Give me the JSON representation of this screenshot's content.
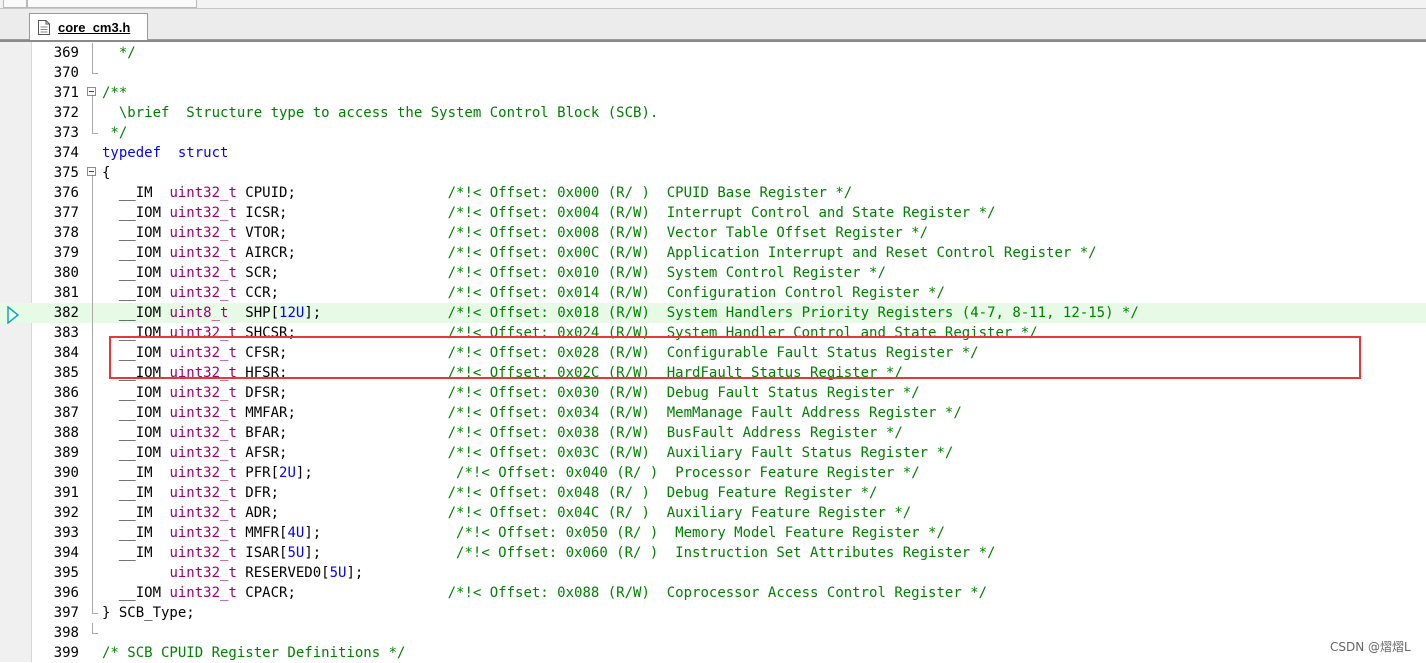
{
  "window": {
    "tab_label": "core_cm3.h",
    "watermark": "CSDN @熠熠L"
  },
  "colors": {
    "keyword": "#0000ff",
    "type": "#a0006a",
    "comment": "#008000",
    "number": "#0000ff",
    "highlight_bg": "#e6fae6",
    "annotation_box": "#e53935"
  },
  "editor": {
    "current_line": 382,
    "lines": [
      {
        "n": "369",
        "fold": "mid",
        "segs": [
          [
            "cm",
            "  */"
          ]
        ]
      },
      {
        "n": "370",
        "fold": "end",
        "segs": []
      },
      {
        "n": "371",
        "fold": "box",
        "segs": [
          [
            "cm",
            "/**"
          ]
        ]
      },
      {
        "n": "372",
        "fold": "mid",
        "segs": [
          [
            "cm",
            "  \\brief  Structure type to access the System Control Block (SCB)."
          ]
        ]
      },
      {
        "n": "373",
        "fold": "end",
        "segs": [
          [
            "cm",
            " */"
          ]
        ]
      },
      {
        "n": "374",
        "fold": "",
        "segs": [
          [
            "kw",
            "typedef"
          ],
          [
            "",
            "  "
          ],
          [
            "kw",
            "struct"
          ]
        ]
      },
      {
        "n": "375",
        "fold": "box",
        "segs": [
          [
            "",
            "{"
          ]
        ]
      },
      {
        "n": "376",
        "fold": "mid",
        "segs": [
          [
            "",
            "  __IM  "
          ],
          [
            "ty",
            "uint32_t"
          ],
          [
            "",
            " CPUID;                  "
          ],
          [
            "cm",
            "/*!< Offset: 0x000 (R/ )  CPUID Base Register */"
          ]
        ]
      },
      {
        "n": "377",
        "fold": "mid",
        "segs": [
          [
            "",
            "  __IOM "
          ],
          [
            "ty",
            "uint32_t"
          ],
          [
            "",
            " ICSR;                   "
          ],
          [
            "cm",
            "/*!< Offset: 0x004 (R/W)  Interrupt Control and State Register */"
          ]
        ]
      },
      {
        "n": "378",
        "fold": "mid",
        "segs": [
          [
            "",
            "  __IOM "
          ],
          [
            "ty",
            "uint32_t"
          ],
          [
            "",
            " VTOR;                   "
          ],
          [
            "cm",
            "/*!< Offset: 0x008 (R/W)  Vector Table Offset Register */"
          ]
        ]
      },
      {
        "n": "379",
        "fold": "mid",
        "segs": [
          [
            "",
            "  __IOM "
          ],
          [
            "ty",
            "uint32_t"
          ],
          [
            "",
            " AIRCR;                  "
          ],
          [
            "cm",
            "/*!< Offset: 0x00C (R/W)  Application Interrupt and Reset Control Register */"
          ]
        ]
      },
      {
        "n": "380",
        "fold": "mid",
        "segs": [
          [
            "",
            "  __IOM "
          ],
          [
            "ty",
            "uint32_t"
          ],
          [
            "",
            " SCR;                    "
          ],
          [
            "cm",
            "/*!< Offset: 0x010 (R/W)  System Control Register */"
          ]
        ]
      },
      {
        "n": "381",
        "fold": "mid",
        "segs": [
          [
            "",
            "  __IOM "
          ],
          [
            "ty",
            "uint32_t"
          ],
          [
            "",
            " CCR;                    "
          ],
          [
            "cm",
            "/*!< Offset: 0x014 (R/W)  Configuration Control Register */"
          ]
        ]
      },
      {
        "n": "382",
        "fold": "mid",
        "highlight": true,
        "segs": [
          [
            "",
            "  __IOM "
          ],
          [
            "ty",
            "uint8_t"
          ],
          [
            "",
            "  SHP["
          ],
          [
            "nm",
            "12U"
          ],
          [
            "",
            "];               "
          ],
          [
            "cm",
            "/*!< Offset: 0x018 (R/W)  System Handlers Priority Registers (4-7, 8-11, 12-15) */"
          ]
        ]
      },
      {
        "n": "383",
        "fold": "mid",
        "segs": [
          [
            "",
            "  __IOM "
          ],
          [
            "ty",
            "uint32_t"
          ],
          [
            "",
            " SHCSR;                  "
          ],
          [
            "cm",
            "/*!< Offset: 0x024 (R/W)  System Handler Control and State Register */"
          ]
        ]
      },
      {
        "n": "384",
        "fold": "mid",
        "segs": [
          [
            "",
            "  __IOM "
          ],
          [
            "ty",
            "uint32_t"
          ],
          [
            "",
            " CFSR;                   "
          ],
          [
            "cm",
            "/*!< Offset: 0x028 (R/W)  Configurable Fault Status Register */"
          ]
        ]
      },
      {
        "n": "385",
        "fold": "mid",
        "segs": [
          [
            "",
            "  __IOM "
          ],
          [
            "ty",
            "uint32_t"
          ],
          [
            "",
            " HFSR;                   "
          ],
          [
            "cm",
            "/*!< Offset: 0x02C (R/W)  HardFault Status Register */"
          ]
        ]
      },
      {
        "n": "386",
        "fold": "mid",
        "segs": [
          [
            "",
            "  __IOM "
          ],
          [
            "ty",
            "uint32_t"
          ],
          [
            "",
            " DFSR;                   "
          ],
          [
            "cm",
            "/*!< Offset: 0x030 (R/W)  Debug Fault Status Register */"
          ]
        ]
      },
      {
        "n": "387",
        "fold": "mid",
        "segs": [
          [
            "",
            "  __IOM "
          ],
          [
            "ty",
            "uint32_t"
          ],
          [
            "",
            " MMFAR;                  "
          ],
          [
            "cm",
            "/*!< Offset: 0x034 (R/W)  MemManage Fault Address Register */"
          ]
        ]
      },
      {
        "n": "388",
        "fold": "mid",
        "segs": [
          [
            "",
            "  __IOM "
          ],
          [
            "ty",
            "uint32_t"
          ],
          [
            "",
            " BFAR;                   "
          ],
          [
            "cm",
            "/*!< Offset: 0x038 (R/W)  BusFault Address Register */"
          ]
        ]
      },
      {
        "n": "389",
        "fold": "mid",
        "segs": [
          [
            "",
            "  __IOM "
          ],
          [
            "ty",
            "uint32_t"
          ],
          [
            "",
            " AFSR;                   "
          ],
          [
            "cm",
            "/*!< Offset: 0x03C (R/W)  Auxiliary Fault Status Register */"
          ]
        ]
      },
      {
        "n": "390",
        "fold": "mid",
        "segs": [
          [
            "",
            "  __IM  "
          ],
          [
            "ty",
            "uint32_t"
          ],
          [
            "",
            " PFR["
          ],
          [
            "nm",
            "2U"
          ],
          [
            "",
            "];                 "
          ],
          [
            "cm",
            "/*!< Offset: 0x040 (R/ )  Processor Feature Register */"
          ]
        ]
      },
      {
        "n": "391",
        "fold": "mid",
        "segs": [
          [
            "",
            "  __IM  "
          ],
          [
            "ty",
            "uint32_t"
          ],
          [
            "",
            " DFR;                    "
          ],
          [
            "cm",
            "/*!< Offset: 0x048 (R/ )  Debug Feature Register */"
          ]
        ]
      },
      {
        "n": "392",
        "fold": "mid",
        "segs": [
          [
            "",
            "  __IM  "
          ],
          [
            "ty",
            "uint32_t"
          ],
          [
            "",
            " ADR;                    "
          ],
          [
            "cm",
            "/*!< Offset: 0x04C (R/ )  Auxiliary Feature Register */"
          ]
        ]
      },
      {
        "n": "393",
        "fold": "mid",
        "segs": [
          [
            "",
            "  __IM  "
          ],
          [
            "ty",
            "uint32_t"
          ],
          [
            "",
            " MMFR["
          ],
          [
            "nm",
            "4U"
          ],
          [
            "",
            "];                "
          ],
          [
            "cm",
            "/*!< Offset: 0x050 (R/ )  Memory Model Feature Register */"
          ]
        ]
      },
      {
        "n": "394",
        "fold": "mid",
        "segs": [
          [
            "",
            "  __IM  "
          ],
          [
            "ty",
            "uint32_t"
          ],
          [
            "",
            " ISAR["
          ],
          [
            "nm",
            "5U"
          ],
          [
            "",
            "];                "
          ],
          [
            "cm",
            "/*!< Offset: 0x060 (R/ )  Instruction Set Attributes Register */"
          ]
        ]
      },
      {
        "n": "395",
        "fold": "mid",
        "segs": [
          [
            "",
            "        "
          ],
          [
            "ty",
            "uint32_t"
          ],
          [
            "",
            " RESERVED0["
          ],
          [
            "nm",
            "5U"
          ],
          [
            "",
            "];"
          ]
        ]
      },
      {
        "n": "396",
        "fold": "mid",
        "segs": [
          [
            "",
            "  __IOM "
          ],
          [
            "ty",
            "uint32_t"
          ],
          [
            "",
            " CPACR;                  "
          ],
          [
            "cm",
            "/*!< Offset: 0x088 (R/W)  Coprocessor Access Control Register */"
          ]
        ]
      },
      {
        "n": "397",
        "fold": "end",
        "segs": [
          [
            "",
            "} SCB_Type;"
          ]
        ]
      },
      {
        "n": "398",
        "fold": "end",
        "segs": []
      },
      {
        "n": "399",
        "fold": "",
        "segs": [
          [
            "cm",
            "/* SCB CPUID Register Definitions */"
          ]
        ]
      }
    ]
  }
}
